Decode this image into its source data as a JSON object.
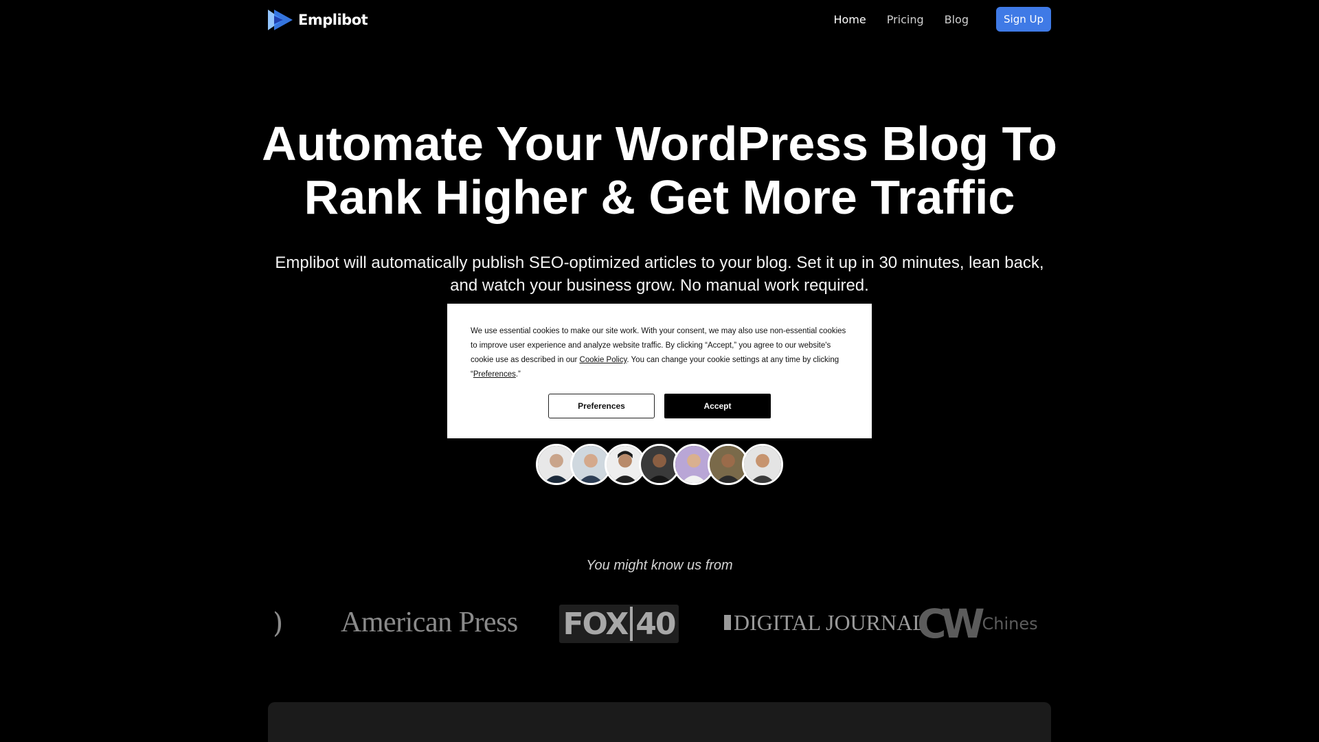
{
  "nav": {
    "brand": "Emplibot",
    "links": [
      {
        "label": "Home"
      },
      {
        "label": "Pricing"
      },
      {
        "label": "Blog"
      }
    ],
    "signup_label": "Sign Up"
  },
  "hero": {
    "title_line1": "Automate Your WordPress Blog To",
    "title_line2": "Rank Higher & Get More Traffic",
    "subtitle_line1": "Emplibot will automatically publish SEO-optimized articles to your blog. Set it up in 30 minutes, lean back,",
    "subtitle_line2": "and watch your business grow. No manual work required."
  },
  "cookie": {
    "text_part1": "We use essential cookies to make our site work. With your consent, we may also use non-essential cookies to improve user experience and analyze website traffic. By clicking “Accept,” you agree to our website's cookie use as described in our ",
    "policy_link": "Cookie Policy",
    "text_part2": ". You can change your cookie settings at any time by clicking “",
    "preferences_link": "Preferences",
    "text_part3": ".”",
    "preferences_button": "Preferences",
    "accept_button": "Accept"
  },
  "avatars": [
    "avatar-1",
    "avatar-2",
    "avatar-3",
    "avatar-4",
    "avatar-5",
    "avatar-6",
    "avatar-7"
  ],
  "press": {
    "heading": "You might know us from",
    "partial": ")",
    "american_press": "American Press",
    "fox_left": "FOX",
    "fox_right": "40",
    "digital_journal": "DIGITAL JOURNAL",
    "cw_mark": "CW",
    "chinese_partial": "Chines"
  },
  "colors": {
    "background": "#000000",
    "accent": "#3f7ae6",
    "logo_blue": "#3b82f6",
    "logo_light": "#93c5fd"
  }
}
